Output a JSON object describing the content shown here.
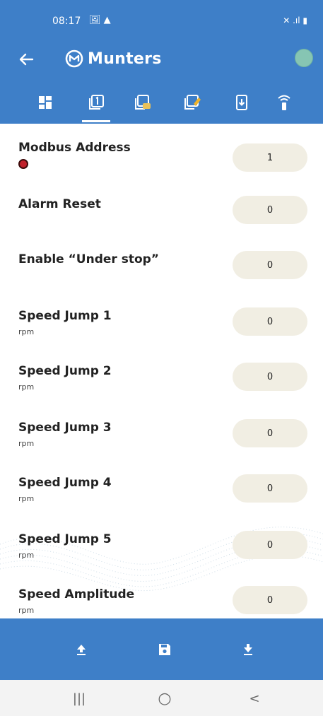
{
  "status_bar": {
    "time": "08:17",
    "left_icons": "🖼 ▲",
    "right_icons": "✕ .ıl ▮"
  },
  "app_bar": {
    "brand": "Munters",
    "back_icon": "arrow-left-icon",
    "status_dot_color": "#86c5b3"
  },
  "tabs": [
    {
      "icon": "dashboard-icon",
      "active": false
    },
    {
      "icon": "device-1-icon",
      "active": true
    },
    {
      "icon": "device-settings-icon",
      "active": false
    },
    {
      "icon": "device-edit-icon",
      "active": false
    },
    {
      "icon": "phone-download-icon",
      "active": false
    },
    {
      "icon": "wireless-icon",
      "active": false
    }
  ],
  "rows": [
    {
      "label": "Modbus Address",
      "unit": "",
      "value": "1",
      "badge": true
    },
    {
      "label": "Alarm Reset",
      "unit": "",
      "value": "0",
      "badge": false
    },
    {
      "label": "Enable “Under stop”",
      "unit": "",
      "value": "0",
      "badge": false
    },
    {
      "label": "Speed Jump 1",
      "unit": "rpm",
      "value": "0",
      "badge": false
    },
    {
      "label": "Speed Jump 2",
      "unit": "rpm",
      "value": "0",
      "badge": false
    },
    {
      "label": "Speed Jump 3",
      "unit": "rpm",
      "value": "0",
      "badge": false
    },
    {
      "label": "Speed Jump 4",
      "unit": "rpm",
      "value": "0",
      "badge": false
    },
    {
      "label": "Speed Jump 5",
      "unit": "rpm",
      "value": "0",
      "badge": false
    },
    {
      "label": "Speed Amplitude",
      "unit": "rpm",
      "value": "0",
      "badge": false
    }
  ],
  "bottom_actions": [
    {
      "icon": "upload-icon"
    },
    {
      "icon": "save-icon"
    },
    {
      "icon": "download-icon"
    }
  ],
  "nav_bar": {
    "recents": "|||",
    "home": "○",
    "back": "<"
  },
  "colors": {
    "primary": "#3e7fc8",
    "pill": "#f1eee3",
    "badge": "#c0202a"
  }
}
